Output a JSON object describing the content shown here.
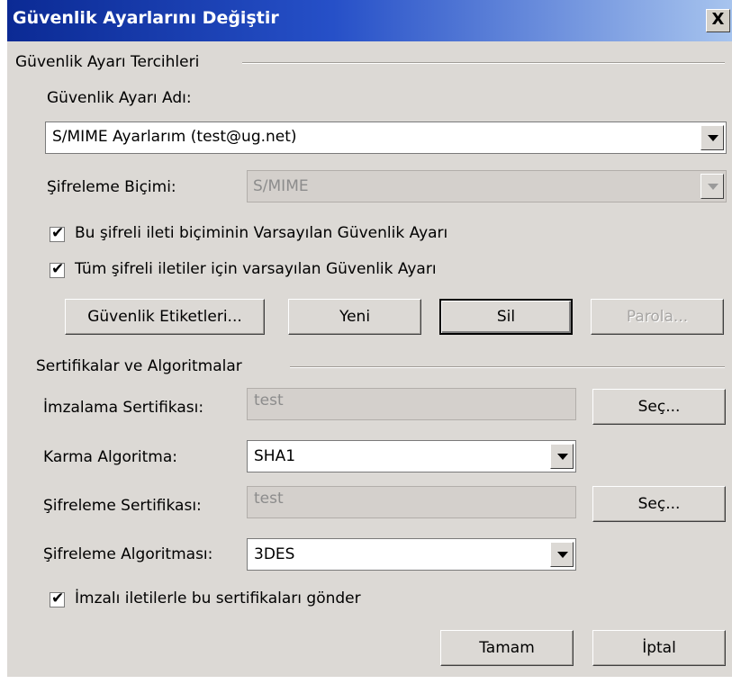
{
  "window": {
    "title": "Güvenlik Ayarlarını Değiştir",
    "close_label": "X"
  },
  "prefs_group": {
    "title": "Güvenlik Ayarı Tercihleri",
    "setting_name_label": "Güvenlik Ayarı Adı:",
    "setting_name_value": "S/MIME Ayarlarım (test@ug.net)",
    "format_label": "Şifreleme Biçimi:",
    "format_value": "S/MIME",
    "checkbox1": {
      "label": "Bu şifreli ileti biçiminin Varsayılan Güvenlik Ayarı",
      "checked": true
    },
    "checkbox2": {
      "label": "Tüm şifreli iletiler için varsayılan Güvenlik Ayarı",
      "checked": true
    },
    "buttons": {
      "security_labels": "Güvenlik Etiketleri...",
      "new": "Yeni",
      "delete": "Sil",
      "password": "Parola..."
    }
  },
  "certs_group": {
    "title": "Sertifikalar ve Algoritmalar",
    "signing_cert_label": "İmzalama Sertifikası:",
    "signing_cert_value": "test",
    "choose1": "Seç...",
    "hash_label": "Karma Algoritma:",
    "hash_value": "SHA1",
    "enc_cert_label": "Şifreleme Sertifikası:",
    "enc_cert_value": "test",
    "choose2": "Seç...",
    "enc_alg_label": "Şifreleme Algoritması:",
    "enc_alg_value": "3DES",
    "send_certs": {
      "label": "İmzalı iletilerle bu sertifikaları gönder",
      "checked": true
    }
  },
  "footer": {
    "ok": "Tamam",
    "cancel": "İptal"
  },
  "icons": {
    "check": "✔"
  }
}
